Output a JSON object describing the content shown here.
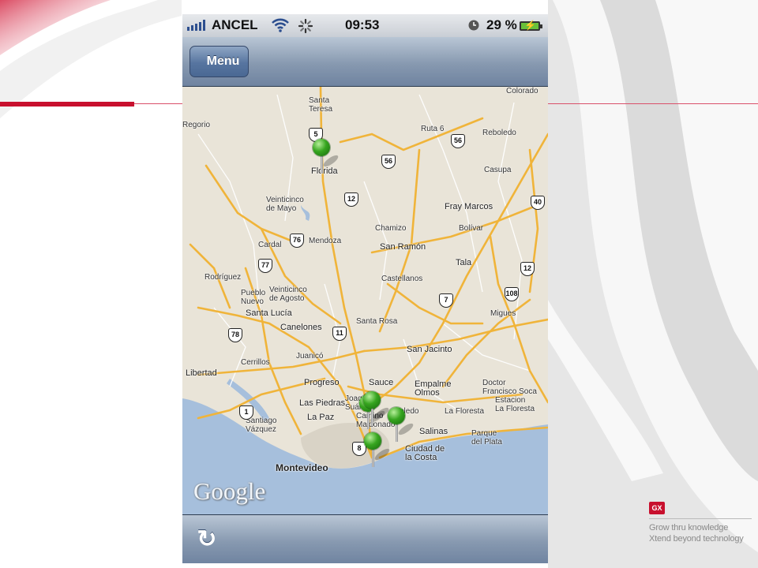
{
  "slide": {
    "brand_logo": "GX",
    "tagline_1": "Grow thru knowledge",
    "tagline_2": "Xtend beyond technology"
  },
  "status_bar": {
    "carrier": "ANCEL",
    "time": "09:53",
    "battery": "29 %",
    "icons": [
      "signal-bars-icon",
      "wifi-icon",
      "activity-spinner-icon",
      "alarm-clock-icon",
      "battery-charging-icon"
    ]
  },
  "nav": {
    "back_label": "Menu"
  },
  "map": {
    "attribution": "Google",
    "places": [
      {
        "name": "Santa\nTeresa",
        "cls": ""
      },
      {
        "name": "Florida",
        "cls": "med"
      },
      {
        "name": "Colorado",
        "cls": ""
      },
      {
        "name": "Reboledo",
        "cls": ""
      },
      {
        "name": "Casupa",
        "cls": ""
      },
      {
        "name": "Fray Marcos",
        "cls": "med"
      },
      {
        "name": "Veinticinco\nde Mayo",
        "cls": ""
      },
      {
        "name": "Chamizo",
        "cls": ""
      },
      {
        "name": "Bolívar",
        "cls": ""
      },
      {
        "name": "Cardal",
        "cls": ""
      },
      {
        "name": "Mendoza",
        "cls": ""
      },
      {
        "name": "San Ramón",
        "cls": "med"
      },
      {
        "name": "Tala",
        "cls": "med"
      },
      {
        "name": "Rodríguez",
        "cls": ""
      },
      {
        "name": "Veinticinco\nde Agosto",
        "cls": ""
      },
      {
        "name": "Castellanos",
        "cls": ""
      },
      {
        "name": "Pueblo\nNuevo",
        "cls": ""
      },
      {
        "name": "Santa Lucía",
        "cls": "med"
      },
      {
        "name": "Canelones",
        "cls": "med"
      },
      {
        "name": "Santa Rosa",
        "cls": ""
      },
      {
        "name": "Migues",
        "cls": ""
      },
      {
        "name": "San Jacinto",
        "cls": "med"
      },
      {
        "name": "Juanicó",
        "cls": ""
      },
      {
        "name": "Cerrillos",
        "cls": ""
      },
      {
        "name": "Libertad",
        "cls": "med"
      },
      {
        "name": "Progreso",
        "cls": "med"
      },
      {
        "name": "Sauce",
        "cls": "med"
      },
      {
        "name": "Empalme\nOlmos",
        "cls": "med"
      },
      {
        "name": "Doctor\nFrancisco Soca",
        "cls": ""
      },
      {
        "name": "Las Piedras",
        "cls": "med"
      },
      {
        "name": "Estacion\nLa Floresta",
        "cls": ""
      },
      {
        "name": "La Floresta",
        "cls": ""
      },
      {
        "name": "Santiago\nVázquez",
        "cls": ""
      },
      {
        "name": "La Paz",
        "cls": "med"
      },
      {
        "name": "Camino\nMaldonado",
        "cls": ""
      },
      {
        "name": "Salinas",
        "cls": "med"
      },
      {
        "name": "Parque\ndel Plata",
        "cls": ""
      },
      {
        "name": "Ciudad de\nla Costa",
        "cls": "med"
      },
      {
        "name": "Montevideo",
        "cls": "big"
      },
      {
        "name": "Regorio",
        "cls": ""
      },
      {
        "name": "Ruta 6",
        "cls": ""
      },
      {
        "name": "Joaquín\nSuárez",
        "cls": ""
      },
      {
        "name": "Toledo",
        "cls": ""
      }
    ],
    "routes": [
      "5",
      "56",
      "56",
      "12",
      "40",
      "76",
      "77",
      "12",
      "7",
      "108",
      "78",
      "11",
      "1",
      "8"
    ],
    "markers": [
      "marker-florida",
      "marker-suarez-a",
      "marker-suarez-b",
      "marker-toledo",
      "marker-camino-maldonado"
    ]
  },
  "toolbar": {
    "refresh_icon": "refresh-icon"
  }
}
